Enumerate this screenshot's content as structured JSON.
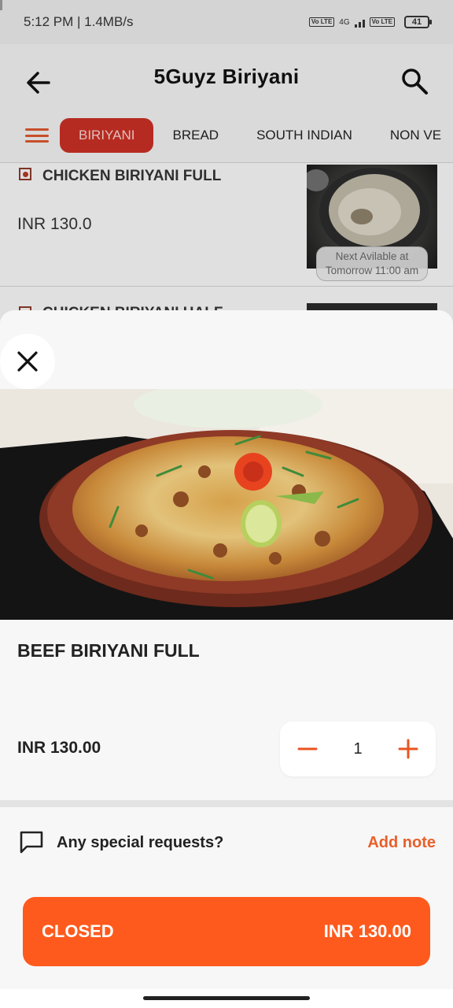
{
  "status_bar": {
    "time_speed": "5:12 PM | 1.4MB/s",
    "network_badge_1": "Vo LTE",
    "network_type": "4G",
    "network_badge_2": "Vo LTE",
    "battery": "41"
  },
  "app_bar": {
    "title": "5Guyz Biriyani"
  },
  "categories": {
    "tabs": [
      {
        "label": "BIRIYANI",
        "active": true
      },
      {
        "label": "BREAD",
        "active": false
      },
      {
        "label": "SOUTH INDIAN",
        "active": false
      },
      {
        "label": "NON VE",
        "active": false
      }
    ]
  },
  "menu_list": {
    "items": [
      {
        "name": "CHICKEN BIRIYANI FULL",
        "price": "INR 130.0",
        "availability": "Next Avilable at Tomorrow 11:00 am"
      },
      {
        "name": "CHICKEN BIRIYANI HALF"
      }
    ]
  },
  "product_sheet": {
    "name": "BEEF BIRIYANI FULL",
    "price": "INR 130.00",
    "quantity": "1",
    "notes_label": "Any special requests?",
    "add_note_label": "Add note",
    "cta_status": "CLOSED",
    "cta_total": "INR 130.00"
  },
  "colors": {
    "accent": "#fe5a1d",
    "tab_active": "#c62f24",
    "add_note": "#e85f2a"
  },
  "icons": [
    "back-arrow-icon",
    "search-icon",
    "hamburger-menu-icon",
    "close-icon",
    "minus-icon",
    "plus-icon",
    "note-icon"
  ]
}
